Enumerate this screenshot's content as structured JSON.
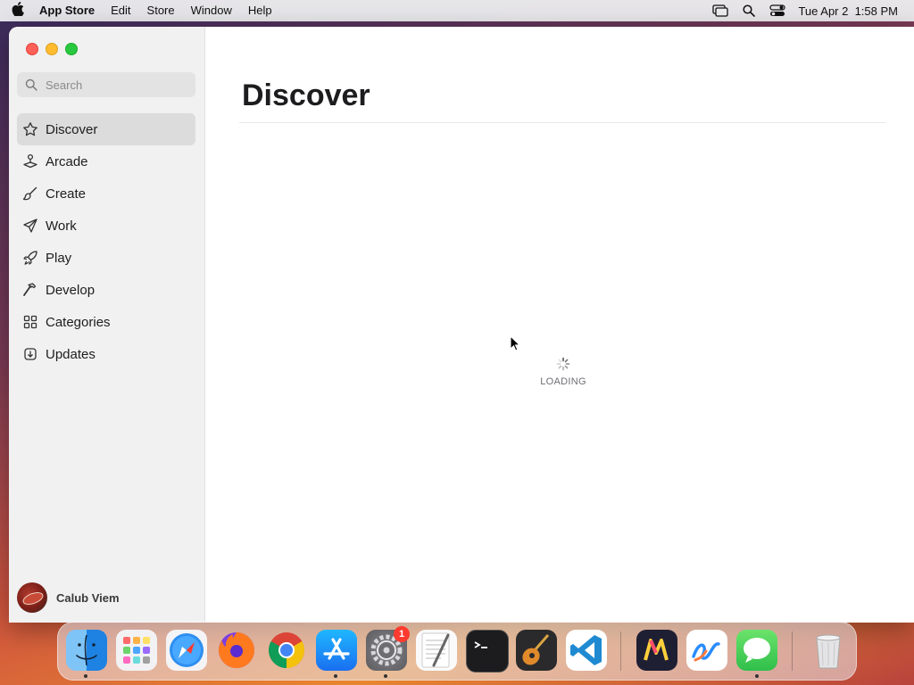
{
  "menubar": {
    "app_name": "App Store",
    "menus": [
      "Edit",
      "Store",
      "Window",
      "Help"
    ],
    "datetime": "Tue Apr 2  1:58 PM"
  },
  "sidebar": {
    "search_placeholder": "Search",
    "items": [
      {
        "label": "Discover",
        "icon": "star-icon",
        "active": true
      },
      {
        "label": "Arcade",
        "icon": "joystick-icon"
      },
      {
        "label": "Create",
        "icon": "paintbrush-icon"
      },
      {
        "label": "Work",
        "icon": "paperplane-icon"
      },
      {
        "label": "Play",
        "icon": "rocket-icon"
      },
      {
        "label": "Develop",
        "icon": "hammer-icon"
      },
      {
        "label": "Categories",
        "icon": "grid-icon"
      },
      {
        "label": "Updates",
        "icon": "download-icon"
      }
    ],
    "user_name": "Calub Viem"
  },
  "main": {
    "title": "Discover",
    "loading_text": "LOADING"
  },
  "dock": {
    "apps": [
      {
        "name": "Finder",
        "icon": "finder-icon",
        "running": true
      },
      {
        "name": "Launchpad",
        "icon": "launchpad-icon"
      },
      {
        "name": "Safari",
        "icon": "safari-icon"
      },
      {
        "name": "Firefox",
        "icon": "firefox-icon"
      },
      {
        "name": "Chrome",
        "icon": "chrome-icon"
      },
      {
        "name": "App Store",
        "icon": "appstore-icon",
        "running": true
      },
      {
        "name": "System Settings",
        "icon": "settings-icon",
        "running": true,
        "badge": "1"
      },
      {
        "name": "TextEdit",
        "icon": "textedit-icon"
      },
      {
        "name": "Terminal",
        "icon": "terminal-icon"
      },
      {
        "name": "GarageBand",
        "icon": "guitar-icon"
      },
      {
        "name": "VS Code",
        "icon": "vscode-icon"
      },
      {
        "name": "Miro",
        "icon": "miro-icon"
      },
      {
        "name": "Freeform",
        "icon": "freeform-icon"
      },
      {
        "name": "Messages",
        "icon": "messages-icon",
        "running": true
      },
      {
        "name": "Trash",
        "icon": "trash-icon"
      }
    ]
  },
  "colors": {
    "close": "#fe5f57",
    "minimize": "#febc2e",
    "maximize": "#28c840",
    "badge": "#ff3b30"
  }
}
